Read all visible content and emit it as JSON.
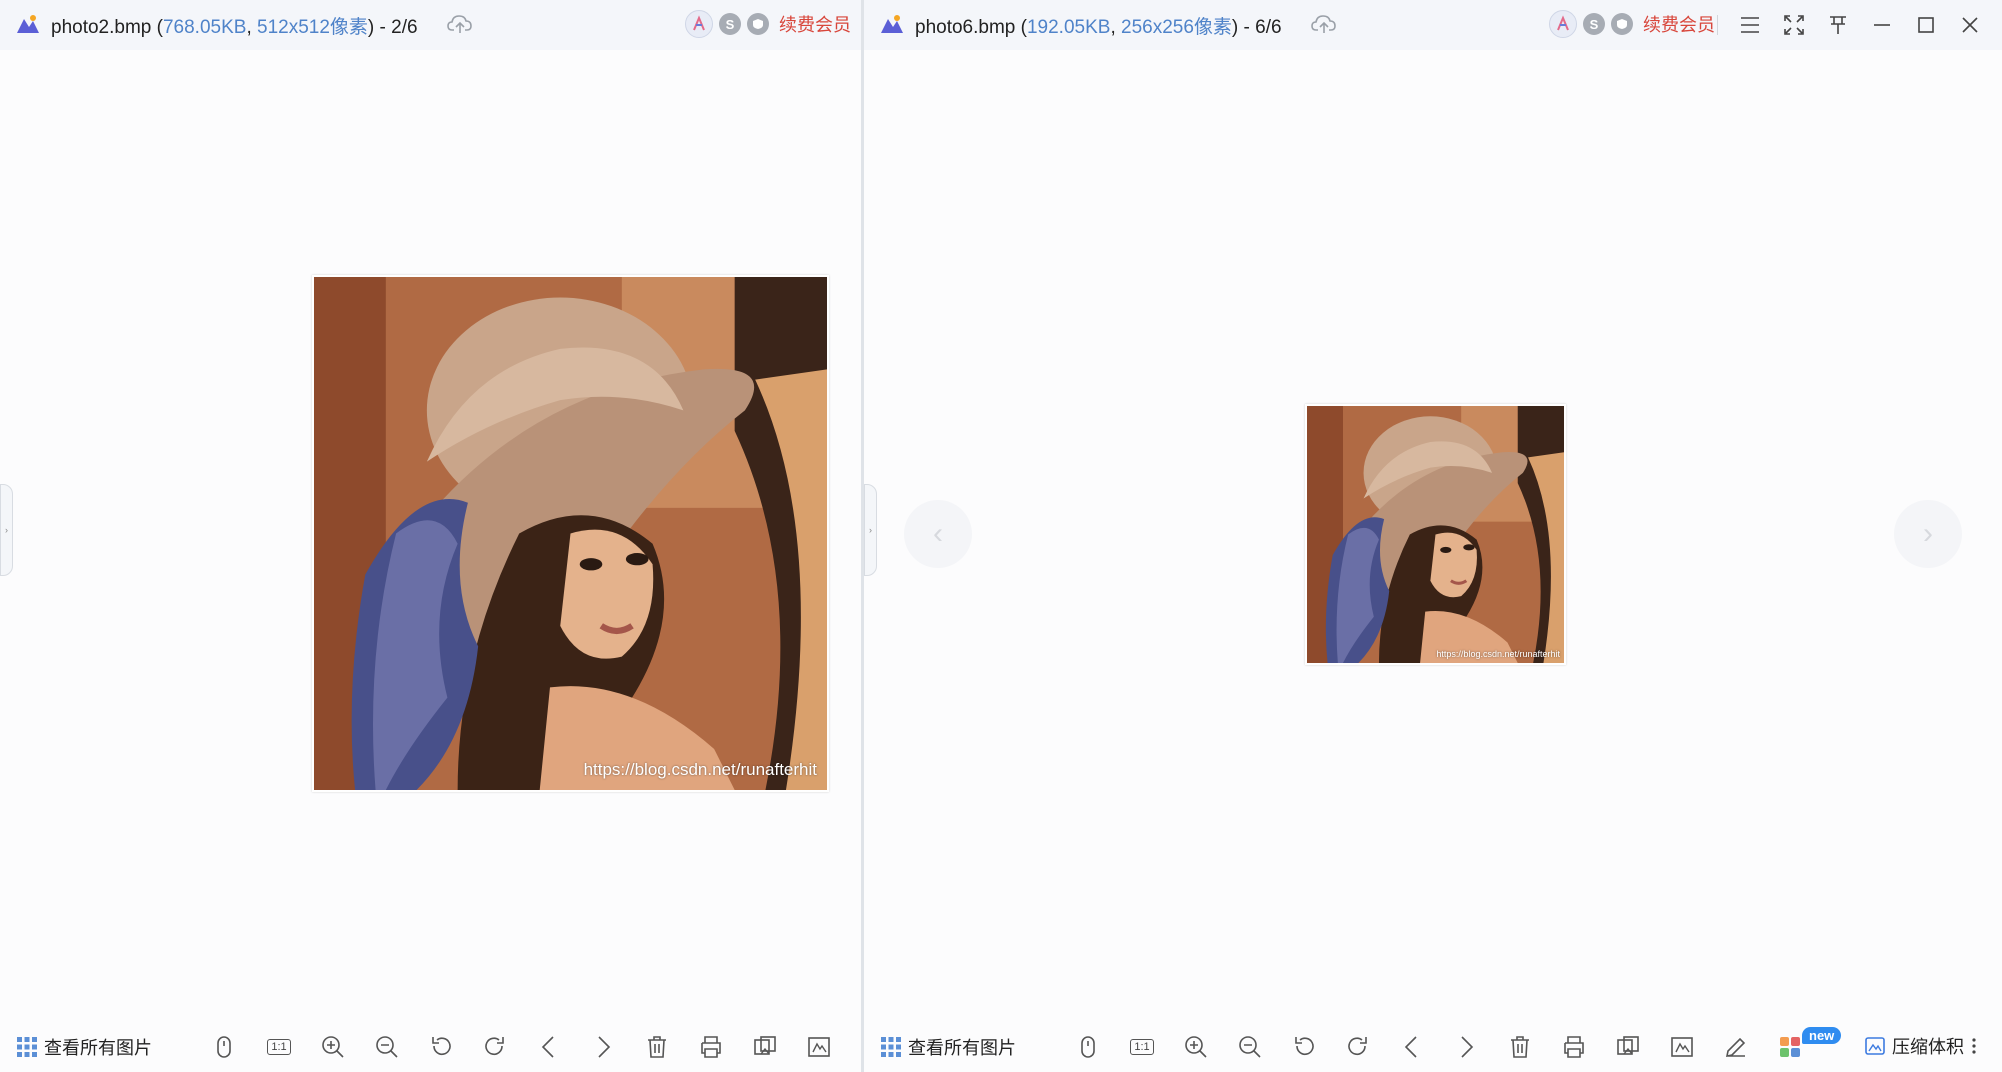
{
  "left": {
    "filename": "photo2.bmp",
    "filesize": "768.05KB",
    "dimensions": "512x512像素",
    "position": "2/6",
    "vip_label": "续费会员",
    "watermark": "https://blog.csdn.net/runafterhit",
    "view_all_label": "查看所有图片"
  },
  "right": {
    "filename": "photo6.bmp",
    "filesize": "192.05KB",
    "dimensions": "256x256像素",
    "position": "6/6",
    "vip_label": "续费会员",
    "watermark": "https://blog.csdn.net/runafterhit",
    "view_all_label": "查看所有图片",
    "compress_label": "压缩体积",
    "new_badge": "new"
  },
  "common": {
    "title_sep": ", ",
    "s_badge": "S",
    "one_to_one": "1:1",
    "side_arrow": "›",
    "nav_prev_glyph": "‹",
    "nav_next_glyph": "›",
    "accent_color": "#4f83c9",
    "vip_color": "#d8463b",
    "badge_color": "#2f8cf0"
  }
}
